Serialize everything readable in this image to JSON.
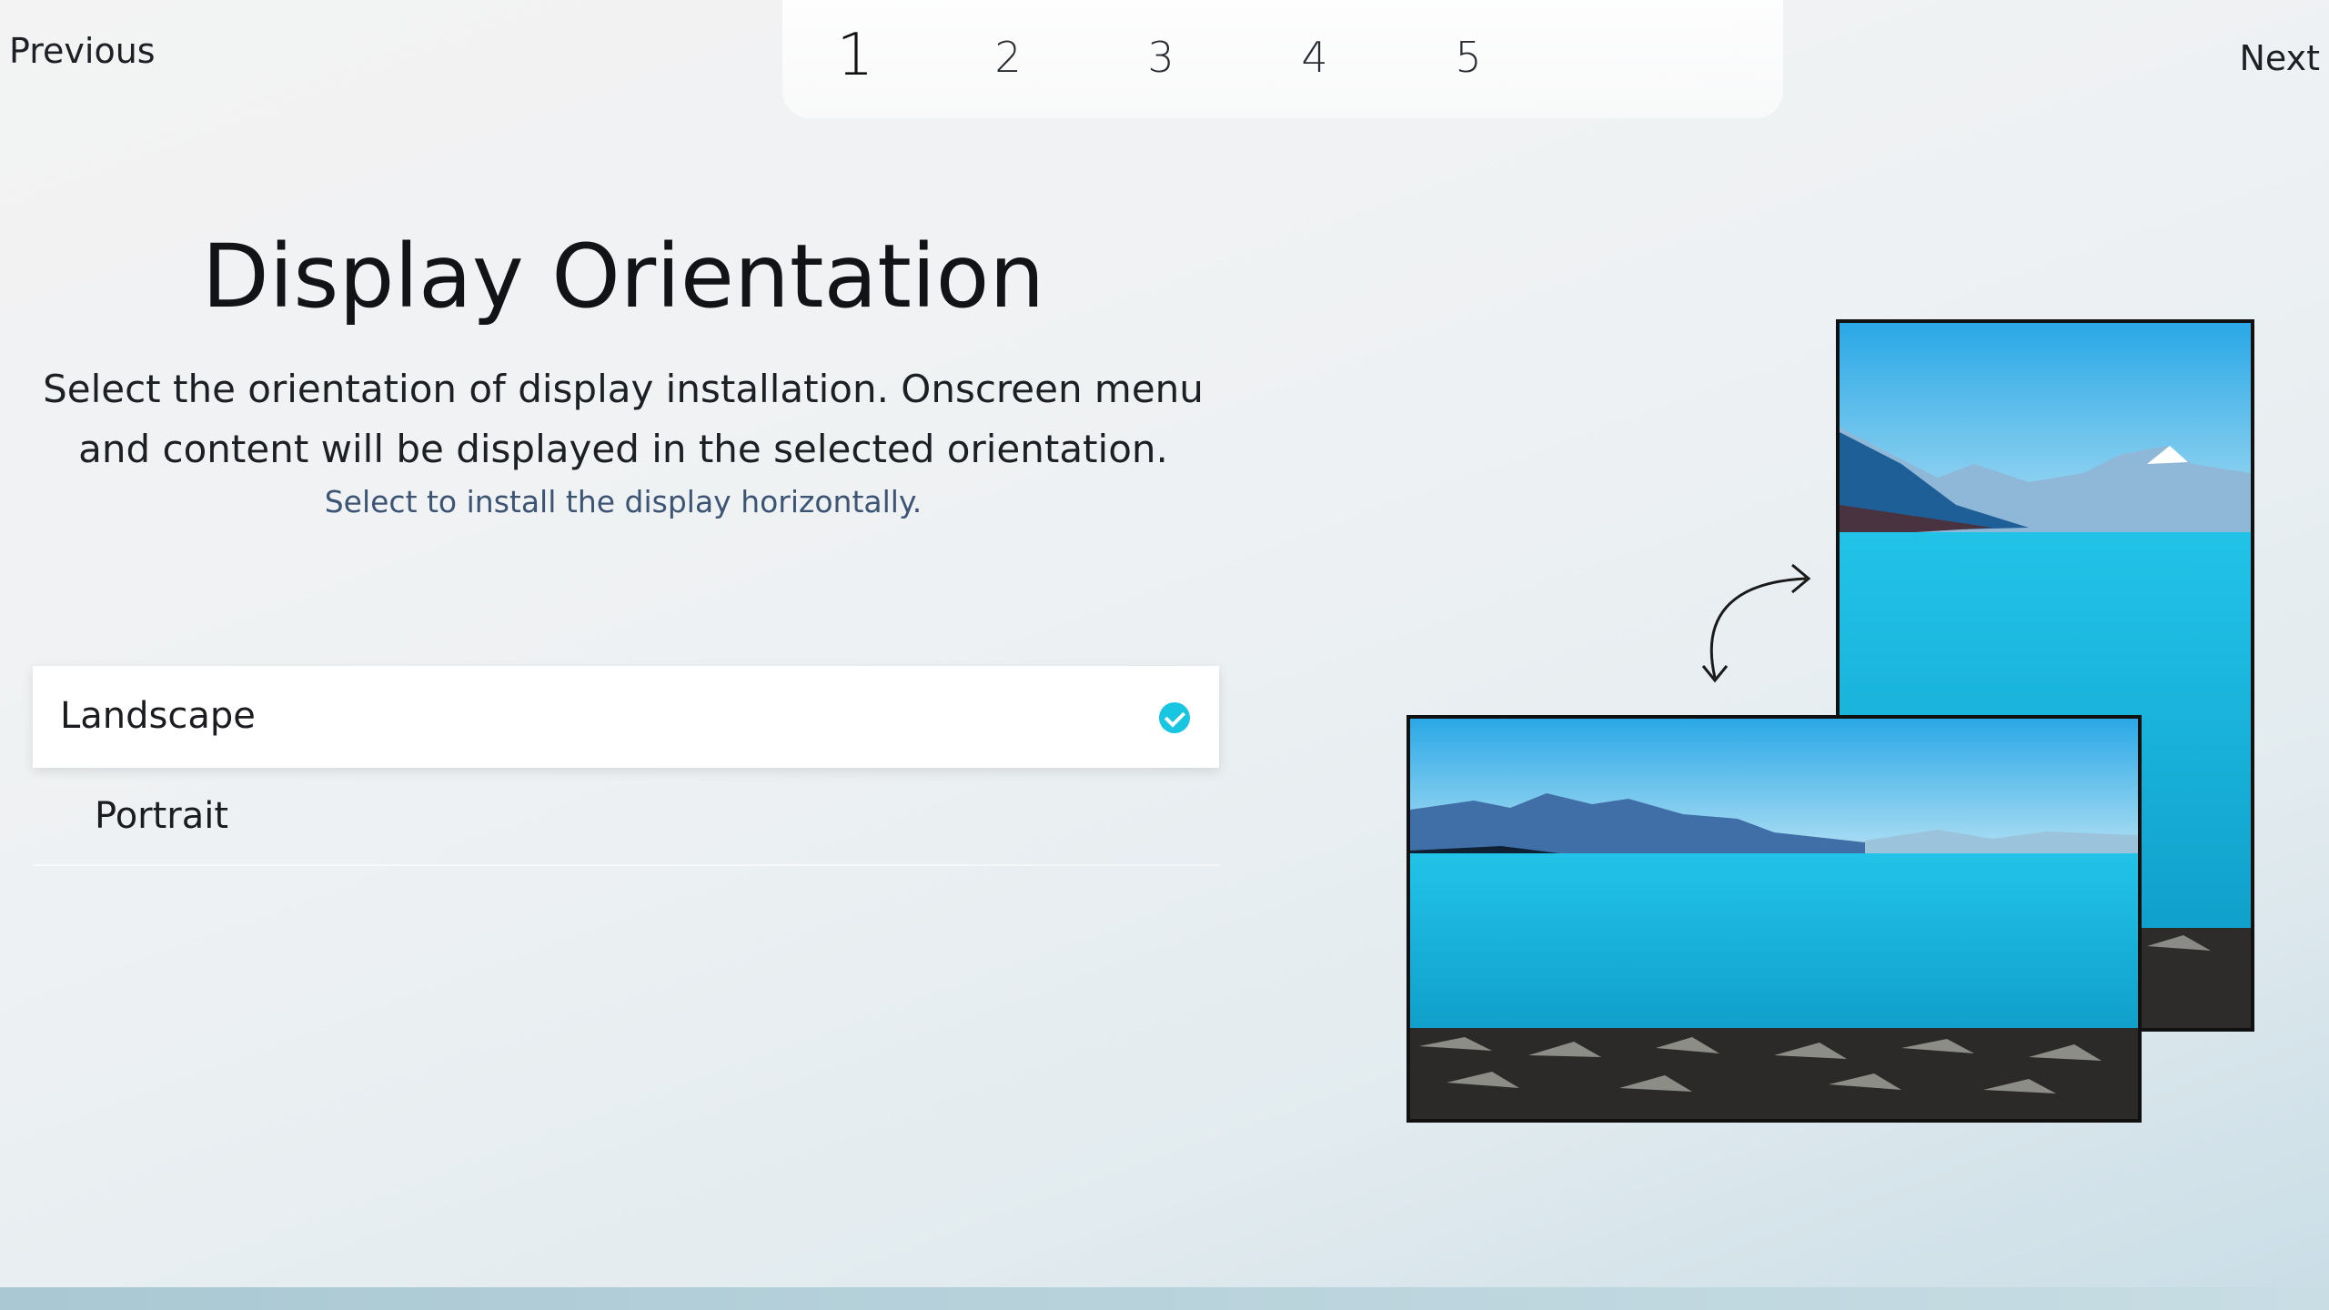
{
  "nav": {
    "previous": "Previous",
    "next": "Next"
  },
  "steps": [
    "1",
    "2",
    "3",
    "4",
    "5"
  ],
  "active_step": 1,
  "title": "Display Orientation",
  "description_line1": "Select the orientation of display installation. Onscreen menu",
  "description_line2": "and content will be displayed in the selected orientation.",
  "hint": "Select to install the display horizontally.",
  "options": [
    {
      "label": "Landscape",
      "selected": true
    },
    {
      "label": "Portrait",
      "selected": false
    }
  ],
  "colors": {
    "accent_check": "#19c6e2",
    "hint_text": "#3c5574"
  },
  "icons": {
    "selected": "check-circle-icon",
    "rotate": "rotate-arrow-icon"
  }
}
